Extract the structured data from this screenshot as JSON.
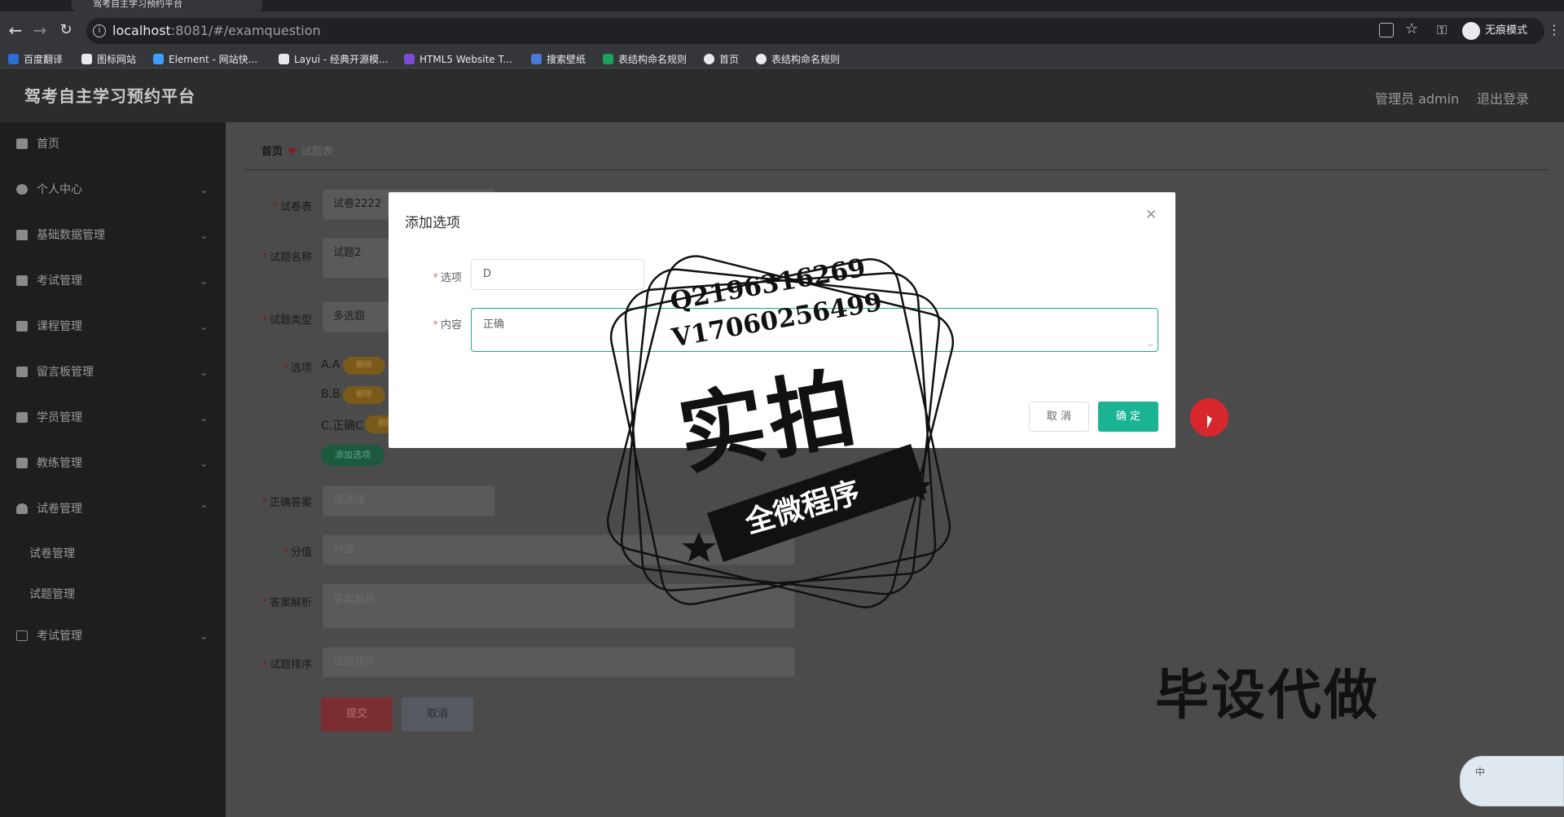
{
  "browser": {
    "tab_title": "驾考自主学习预约平台",
    "url_host": "localhost",
    "url_rest": ":8081/#/examquestion",
    "incognito_label": "无痕模式",
    "bookmarks": [
      {
        "label": "百度翻译",
        "color": "#2b6ed9"
      },
      {
        "label": "图标网站",
        "color": "#e8eaed"
      },
      {
        "label": "Element - 网站快...",
        "color": "#409eff"
      },
      {
        "label": "Layui - 经典开源模...",
        "color": "#e8eaed"
      },
      {
        "label": "HTML5 Website T...",
        "color": "#7b4bd8"
      },
      {
        "label": "搜索壁纸",
        "color": "#4a7bd8"
      },
      {
        "label": "表结构命名规则",
        "color": "#1aa260"
      },
      {
        "label": "首页",
        "color": "#e8eaed"
      },
      {
        "label": "表结构命名规则",
        "color": "#e8eaed"
      }
    ]
  },
  "header": {
    "brand": "驾考自主学习预约平台",
    "admin": "管理员 admin",
    "logout": "退出登录"
  },
  "sidebar": {
    "items": [
      {
        "label": "首页"
      },
      {
        "label": "个人中心"
      },
      {
        "label": "基础数据管理"
      },
      {
        "label": "考试管理"
      },
      {
        "label": "课程管理"
      },
      {
        "label": "留言板管理"
      },
      {
        "label": "学员管理"
      },
      {
        "label": "教练管理"
      },
      {
        "label": "试卷管理"
      },
      {
        "label": "考试管理"
      }
    ],
    "subitems": [
      {
        "label": "试卷管理"
      },
      {
        "label": "试题管理"
      }
    ]
  },
  "breadcrumb": {
    "home": "首页",
    "current": "试题表"
  },
  "form": {
    "paper_label": "试卷表",
    "paper_value": "试卷2222",
    "name_label": "试题名称",
    "name_value": "试题2",
    "type_label": "试题类型",
    "type_value": "多选题",
    "options_label": "选项",
    "options": [
      {
        "text": "A.A"
      },
      {
        "text": "B.B"
      },
      {
        "text": "C.正确C"
      }
    ],
    "delete_label": "删除",
    "add_option_label": "添加选项",
    "answer_label": "正确答案",
    "answer_placeholder": "请选择",
    "score_label": "分值",
    "score_placeholder": "分值",
    "analysis_label": "答案解析",
    "analysis_placeholder": "答案解析",
    "order_label": "试题排序",
    "order_placeholder": "试题排序",
    "submit_label": "提交",
    "cancel_label": "取消"
  },
  "modal": {
    "title": "添加选项",
    "option_label": "选项",
    "option_value": "D",
    "content_label": "内容",
    "content_value": "正确",
    "cancel_label": "取 消",
    "ok_label": "确 定"
  },
  "watermark": {
    "line1": "Q2196316269",
    "line2": "V17060256499",
    "big": "实拍",
    "banner": "全微程序",
    "corner": "毕设代做"
  },
  "ime": {
    "label": "中"
  }
}
